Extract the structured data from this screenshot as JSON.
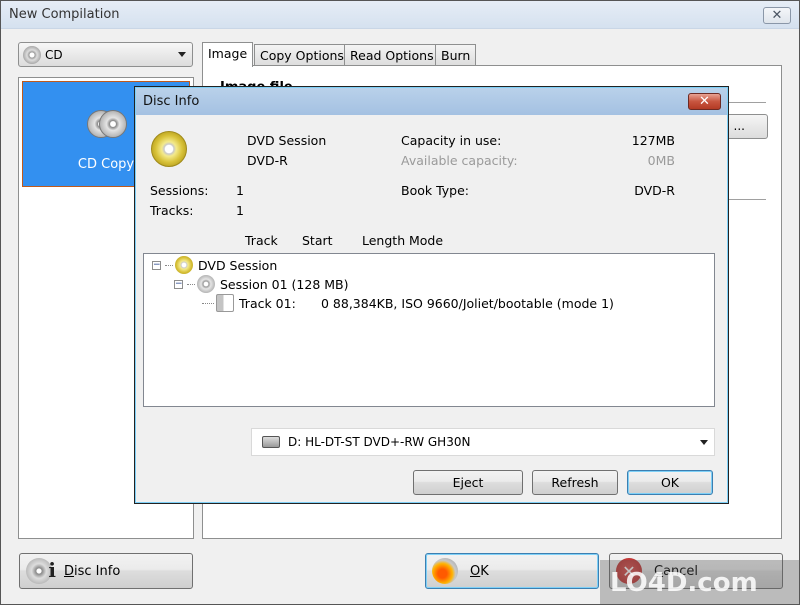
{
  "main_window": {
    "title": "New Compilation",
    "close_label": "✕",
    "type_select": {
      "value": "CD",
      "icon": "cd-icon"
    },
    "mode_list": [
      {
        "label": "CD Copy",
        "icon": "cd-copy-icon",
        "selected": true
      }
    ],
    "tabs": [
      {
        "label": "Image",
        "active": true
      },
      {
        "label": "Copy Options",
        "active": false
      },
      {
        "label": "Read Options",
        "active": false
      },
      {
        "label": "Burn",
        "active": false
      }
    ],
    "panel": {
      "heading": "Image file",
      "browse_label": "..."
    },
    "buttons": {
      "disc_info": {
        "label_underlined": "D",
        "label_rest": "isc Info"
      },
      "ok": {
        "label_underlined": "O",
        "label_rest": "K"
      },
      "cancel": {
        "label_underlined": "C",
        "label_rest": "ancel"
      }
    }
  },
  "dialog": {
    "title": "Disc Info",
    "close_label": "✕",
    "disc_name": "DVD Session",
    "disc_type": "DVD-R",
    "capacity_in_use_label": "Capacity in use:",
    "capacity_in_use_value": "127MB",
    "available_capacity_label": "Available capacity:",
    "available_capacity_value": "0MB",
    "sessions_label": "Sessions:",
    "sessions_value": "1",
    "tracks_label": "Tracks:",
    "tracks_value": "1",
    "book_type_label": "Book Type:",
    "book_type_value": "DVD-R",
    "columns": [
      "Track",
      "Start",
      "Length",
      "Mode"
    ],
    "tree": [
      {
        "level": 0,
        "icon": "gold-disc-icon",
        "label": "DVD Session",
        "expanded": true
      },
      {
        "level": 1,
        "icon": "grey-disc-icon",
        "label": "Session 01 (128 MB)",
        "expanded": true
      },
      {
        "level": 2,
        "icon": "track-icon",
        "label": "Track 01:",
        "detail": "0 88,384KB, ISO 9660/Joliet/bootable (mode 1)"
      }
    ],
    "drive": "D: HL-DT-ST DVD+-RW GH30N",
    "buttons": {
      "eject": "Eject",
      "refresh": "Refresh",
      "ok": "OK"
    }
  },
  "watermark": "LO4D.com"
}
